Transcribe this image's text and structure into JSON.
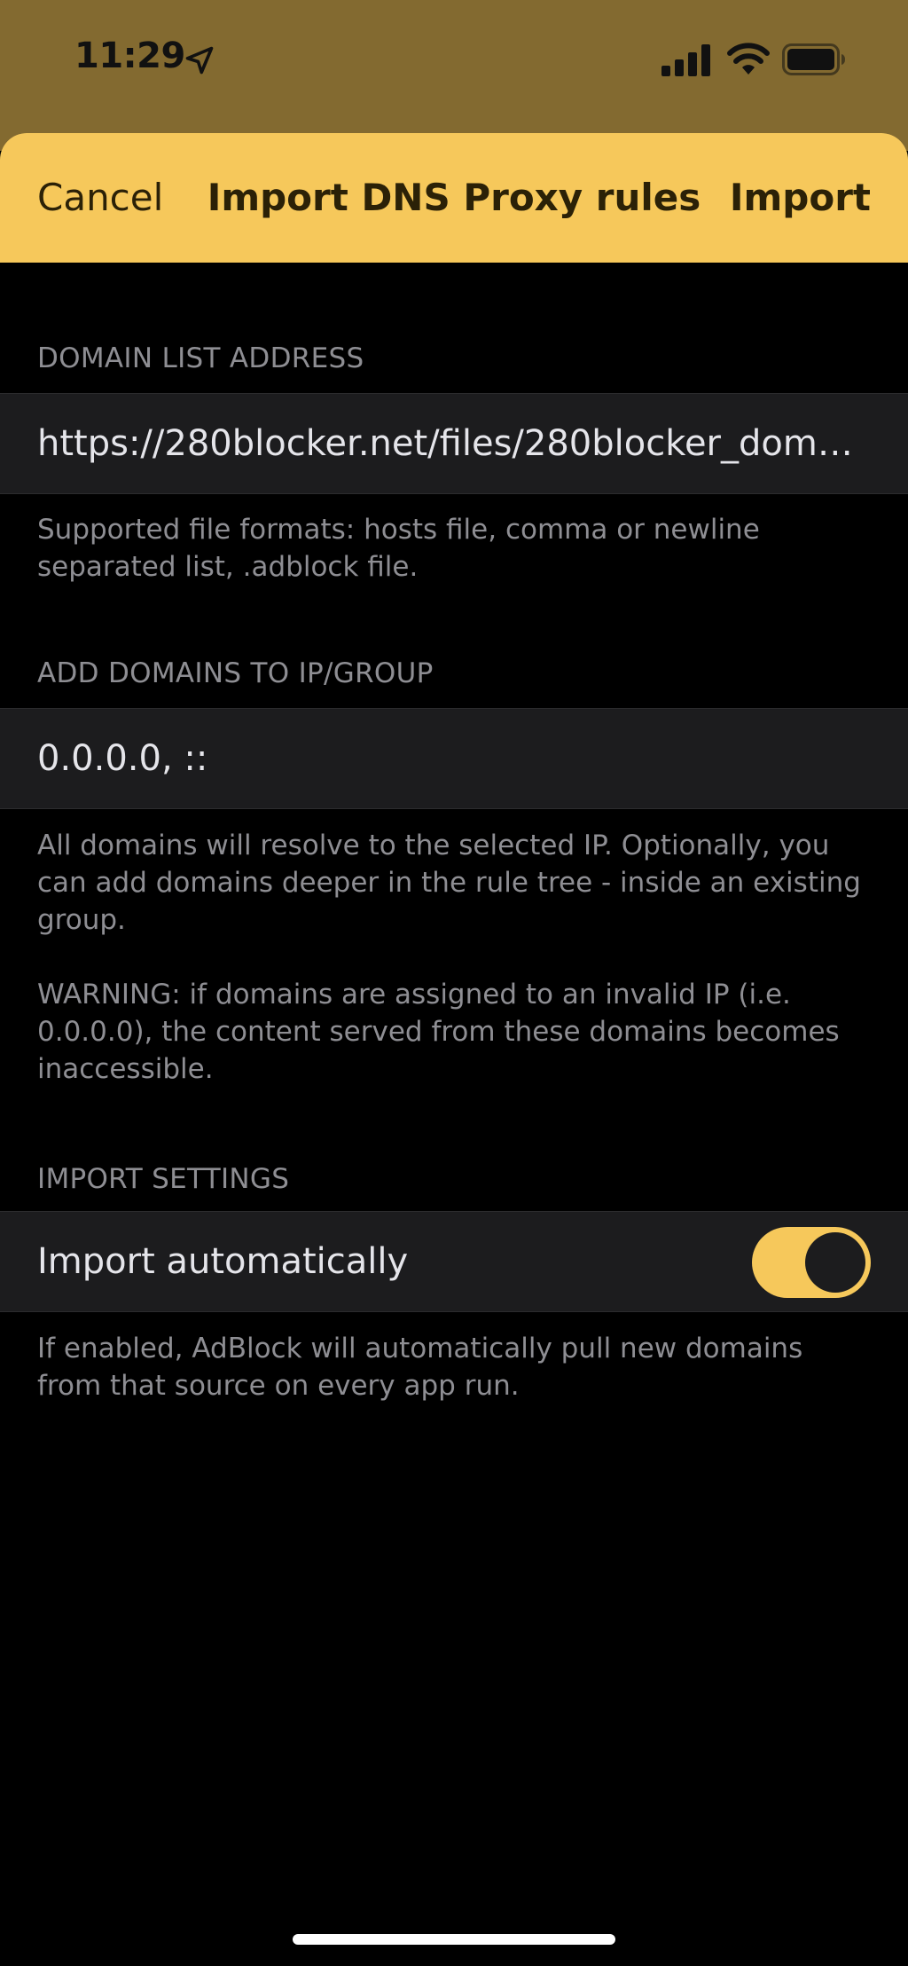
{
  "status_bar": {
    "time": "11:29",
    "icons": [
      "location-arrow-icon",
      "cellular-signal-icon",
      "wifi-icon",
      "battery-icon"
    ]
  },
  "colors": {
    "accent": "#f6c85b",
    "status_background": "#836a30",
    "cell_background": "#1c1c1e",
    "secondary_text": "#8e8e93"
  },
  "navbar": {
    "cancel_label": "Cancel",
    "title": "Import DNS Proxy rules",
    "import_label": "Import"
  },
  "domain_list": {
    "header": "DOMAIN LIST ADDRESS",
    "value": "https://280blocker.net/files/280blocker_domai...",
    "footer": "Supported file formats: hosts file, comma or newline separated list, .adblock file."
  },
  "ip_group": {
    "header": "ADD DOMAINS TO IP/GROUP",
    "value": "0.0.0.0, ::",
    "footer": "All domains will resolve to the selected IP. Optionally, you can add domains deeper in the rule tree - inside an existing group.",
    "warning": "WARNING: if domains are assigned to an invalid IP (i.e. 0.0.0.0), the content served from these domains becomes inaccessible."
  },
  "import_settings": {
    "header": "IMPORT SETTINGS",
    "auto_label": "Import automatically",
    "auto_enabled": true,
    "footer": "If enabled, AdBlock will automatically pull new domains from that source on every app run."
  }
}
